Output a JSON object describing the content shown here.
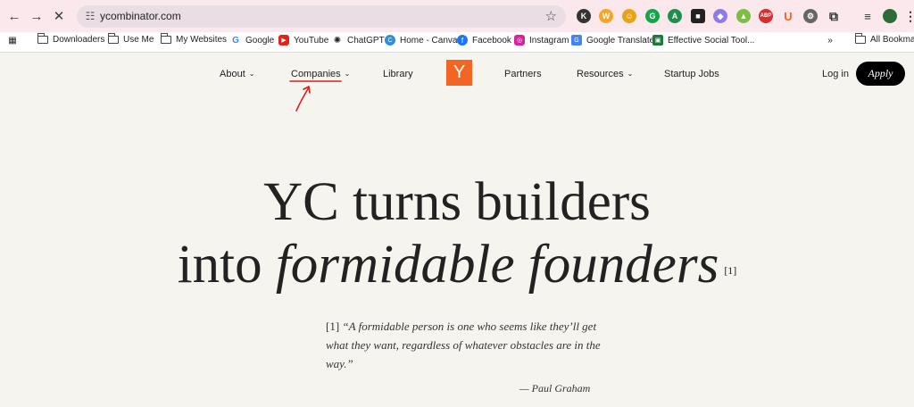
{
  "browser": {
    "url": "ycombinator.com",
    "extensions": [
      "K",
      "W",
      "☺",
      "G",
      "A",
      "■",
      "◆",
      "▲",
      "ABP",
      "U",
      "⚙"
    ]
  },
  "bookmarks": [
    {
      "label": "Downloaders",
      "icon": "folder-icon"
    },
    {
      "label": "Use Me",
      "icon": "folder-icon"
    },
    {
      "label": "My Websites",
      "icon": "folder-icon"
    },
    {
      "label": "Google",
      "icon": "google-icon"
    },
    {
      "label": "YouTube",
      "icon": "youtube-icon"
    },
    {
      "label": "ChatGPT",
      "icon": "chatgpt-icon"
    },
    {
      "label": "Home - Canva",
      "icon": "canva-icon"
    },
    {
      "label": "Facebook",
      "icon": "facebook-icon"
    },
    {
      "label": "Instagram",
      "icon": "instagram-icon"
    },
    {
      "label": "Google Translate",
      "icon": "translate-icon"
    },
    {
      "label": "Effective Social Tool...",
      "icon": "tool-icon"
    },
    {
      "label": "All Bookmarks",
      "icon": "folder-icon"
    }
  ],
  "site_nav": {
    "about": "About",
    "companies": "Companies",
    "library": "Library",
    "logo": "Y",
    "partners": "Partners",
    "resources": "Resources",
    "startup_jobs": "Startup Jobs",
    "login": "Log in",
    "apply": "Apply"
  },
  "hero": {
    "line1": "YC turns builders",
    "line2_plain": "into ",
    "line2_italic": "formidable founders",
    "footnote_mark": "[1]"
  },
  "quote": {
    "mark": "[1]",
    "text": "“A formidable person is one who seems like they’ll get what they want, regardless of whatever obstacles are in the way.”",
    "author": "— Paul Graham"
  },
  "colors": {
    "accent": "#f26522",
    "annotation": "#e01b1b",
    "background": "#f5f4ee"
  }
}
